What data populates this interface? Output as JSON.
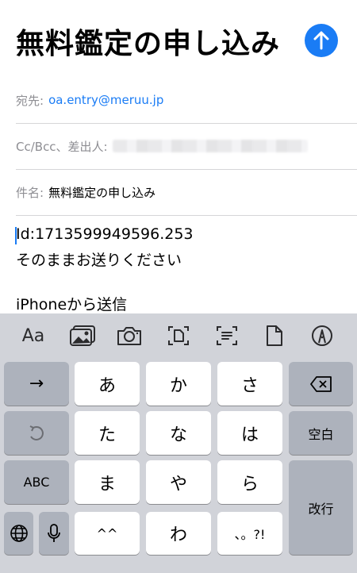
{
  "compose": {
    "title": "無料鑑定の申し込み",
    "to_label": "宛先:",
    "to_value": "oa.entry@meruu.jp",
    "cc_label": "Cc/Bcc、差出人:",
    "subject_label": "件名:",
    "subject_value": "無料鑑定の申し込み",
    "body_line1": "Id:1713599949596.253",
    "body_line2": "そのままお送りください",
    "signature": "iPhoneから送信"
  },
  "toolbar": {
    "format_label": "Aa",
    "icons": [
      "photo-library-icon",
      "camera-icon",
      "scan-document-icon",
      "scan-text-icon",
      "document-icon",
      "markup-icon"
    ]
  },
  "keyboard": {
    "left_keys": [
      "→",
      "↺",
      "ABC",
      "globe"
    ],
    "kana_keys": [
      [
        "あ",
        "か",
        "さ"
      ],
      [
        "た",
        "な",
        "は"
      ],
      [
        "ま",
        "や",
        "ら"
      ],
      [
        "^^",
        "わ",
        "、。?!"
      ]
    ],
    "space_label": "空白",
    "return_label": "改行"
  },
  "colors": {
    "accent": "#1a7cf5",
    "keyboard_bg": "#d1d3d9",
    "key_gray": "#adb2bc"
  }
}
